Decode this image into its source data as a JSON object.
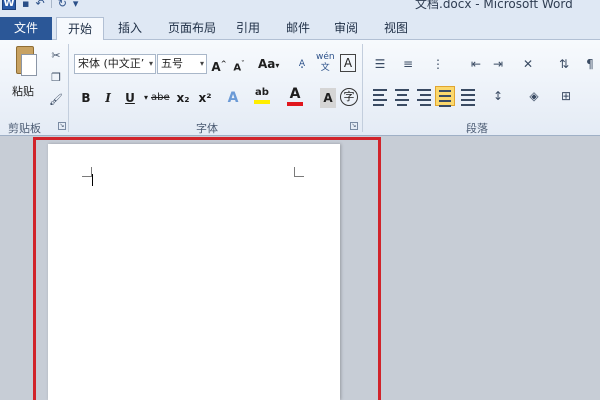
{
  "titlebar": {
    "app_icon": "W",
    "window_title": "文档.docx - Microsoft Word"
  },
  "tabs": {
    "file": "文件",
    "items": [
      "开始",
      "插入",
      "页面布局",
      "引用",
      "邮件",
      "审阅",
      "视图"
    ]
  },
  "ribbon": {
    "clipboard": {
      "paste_label": "粘贴",
      "group_label": "剪贴板"
    },
    "font": {
      "font_name": "宋体 (中文正’",
      "font_size": "五号",
      "grow": "A",
      "shrink": "A",
      "case": "Aa",
      "phonetic": "wén",
      "border_char": "A",
      "bold": "B",
      "italic": "I",
      "underline": "U",
      "strike": "abe",
      "subscript": "x₂",
      "superscript": "x²",
      "effects": "A",
      "highlight": "ab",
      "color": "A",
      "shade": "A",
      "enclose": "字",
      "group_label": "字体"
    },
    "paragraph": {
      "group_label": "段落"
    }
  },
  "colors": {
    "file_tab": "#2b5797",
    "highlight_border": "#d1232a",
    "ribbon_bg": "#e4ebf5",
    "selected_button": "#fbd86c"
  }
}
